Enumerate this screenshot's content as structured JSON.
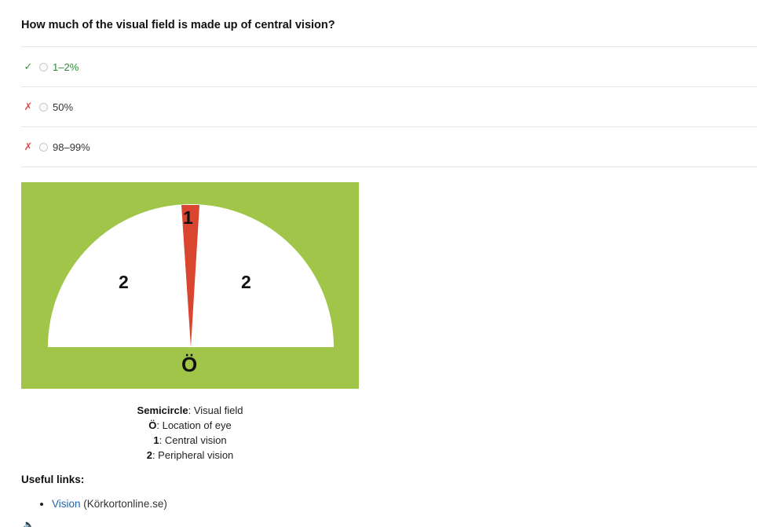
{
  "question": "How much of the visual field is made up of central vision?",
  "answers": [
    {
      "mark": "✓",
      "text": "1–2%",
      "correct": true
    },
    {
      "mark": "✗",
      "text": "50%",
      "correct": false
    },
    {
      "mark": "✗",
      "text": "98–99%",
      "correct": false
    }
  ],
  "figure": {
    "label_central": "1",
    "label_peripheral_left": "2",
    "label_peripheral_right": "2",
    "label_eye": "Ö",
    "colors": {
      "background": "#a0c548",
      "field": "#ffffff",
      "central": "#d9452f"
    }
  },
  "caption": [
    {
      "key": "Semicircle",
      "text": ": Visual field"
    },
    {
      "key": "Ö",
      "text": ": Location of eye"
    },
    {
      "key": "1",
      "text": ": Central vision"
    },
    {
      "key": "2",
      "text": ": Peripheral vision"
    }
  ],
  "useful_links": {
    "heading": "Useful links:",
    "items": [
      {
        "link_text": "Vision",
        "source": " (Körkortonline.se)"
      }
    ]
  },
  "speaker_icon": "speaker-icon"
}
